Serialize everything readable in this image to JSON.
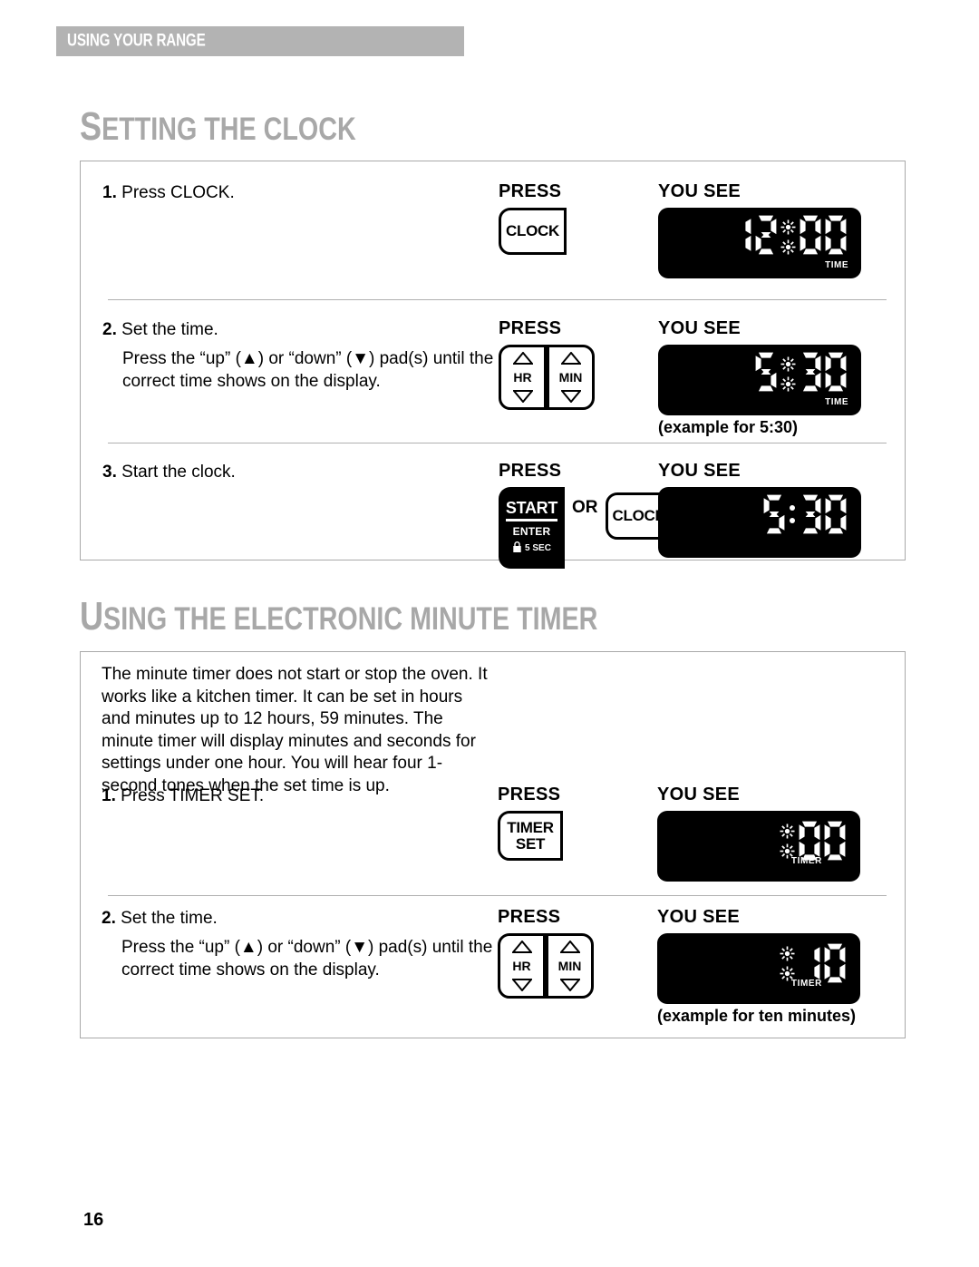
{
  "running_head": "USING YOUR RANGE",
  "page_number": "16",
  "column_headers": {
    "press": "PRESS",
    "you_see": "YOU SEE"
  },
  "sections": [
    {
      "title_cap": "S",
      "title_rest": "ETTING THE CLOCK",
      "title_full": "SETTING THE CLOCK",
      "steps": [
        {
          "number": "1.",
          "text": "Press CLOCK.",
          "subtext": "",
          "pads": [
            {
              "type": "key",
              "label": "CLOCK"
            }
          ],
          "display": {
            "value": "12:00",
            "digits": [
              "1",
              "2",
              "0",
              "0"
            ],
            "colon": "flashing",
            "indicator": "TIME",
            "indicator_position": "corner"
          },
          "caption": ""
        },
        {
          "number": "2.",
          "text": "Set the time.",
          "subtext": "Press the “up” (▲) or “down” (▼) pad(s) until the correct time shows on the display.",
          "pads": [
            {
              "type": "arrow",
              "label": "HR"
            },
            {
              "type": "arrow",
              "label": "MIN"
            }
          ],
          "display": {
            "value": "5:30",
            "digits": [
              "5",
              "3",
              "0"
            ],
            "colon": "flashing",
            "indicator": "TIME",
            "indicator_position": "corner"
          },
          "caption": "(example for 5:30)"
        },
        {
          "number": "3.",
          "text": "Start the clock.",
          "subtext": "",
          "pads": [
            {
              "type": "start",
              "label": "START",
              "sublabel": "ENTER",
              "lock_text": "5 SEC"
            },
            {
              "type": "or",
              "label": "OR"
            },
            {
              "type": "key",
              "label": "CLOCK"
            }
          ],
          "display": {
            "value": "5:30",
            "digits": [
              "5",
              "3",
              "0"
            ],
            "colon": "solid",
            "indicator": "",
            "indicator_position": "none"
          },
          "caption": ""
        }
      ]
    },
    {
      "title_cap": "U",
      "title_rest": "SING THE ELECTRONIC MINUTE TIMER",
      "title_full": "USING THE ELECTRONIC MINUTE TIMER",
      "paragraph": "The minute timer does not start or stop the oven. It works like a kitchen timer. It can be set in hours and minutes up to 12 hours, 59 minutes. The minute timer will display minutes and seconds for settings under one hour. You will hear four 1-second tones when the set time is up.",
      "steps": [
        {
          "number": "1.",
          "text": "Press TIMER SET.",
          "subtext": "",
          "pads": [
            {
              "type": "key2",
              "label": "TIMER",
              "label2": "SET"
            }
          ],
          "display": {
            "value": ":00",
            "digits": [
              "0",
              "0"
            ],
            "colon": "flashing",
            "indicator": "TIMER",
            "indicator_position": "under"
          },
          "caption": ""
        },
        {
          "number": "2.",
          "text": "Set the time.",
          "subtext": "Press the “up” (▲) or “down” (▼) pad(s) until the correct time shows on the display.",
          "pads": [
            {
              "type": "arrow",
              "label": "HR"
            },
            {
              "type": "arrow",
              "label": "MIN"
            }
          ],
          "display": {
            "value": ":10",
            "digits": [
              "1",
              "0"
            ],
            "colon": "flashing",
            "indicator": "TIMER",
            "indicator_position": "under"
          },
          "caption": "(example for ten minutes)"
        }
      ]
    }
  ],
  "colors": {
    "running_head_bar": "#b3b3b3",
    "section_title": "#a8a8a8",
    "panel_border": "#a9a9a9",
    "lcd_background": "#000000",
    "lcd_segment": "#ffffff"
  }
}
